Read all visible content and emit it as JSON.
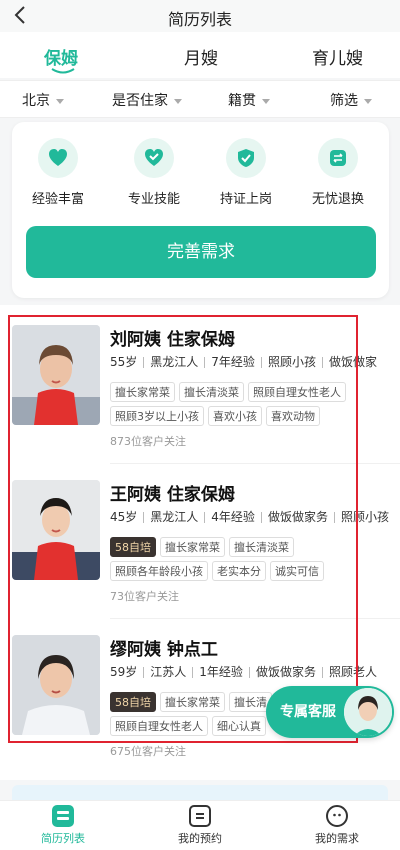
{
  "page": {
    "title": "简历列表"
  },
  "tabs": [
    {
      "label": "保姆",
      "active": true
    },
    {
      "label": "月嫂",
      "active": false
    },
    {
      "label": "育儿嫂",
      "active": false
    }
  ],
  "filters": [
    "北京",
    "是否住家",
    "籍贯",
    "筛选"
  ],
  "features": [
    {
      "label": "经验丰富",
      "icon": "heart-shield-icon"
    },
    {
      "label": "专业技能",
      "icon": "check-heart-icon"
    },
    {
      "label": "持证上岗",
      "icon": "badge-check-icon"
    },
    {
      "label": "无忧退换",
      "icon": "swap-icon"
    }
  ],
  "cta": {
    "label": "完善需求"
  },
  "caregivers": [
    {
      "name": "刘阿姨 住家保姆",
      "meta": [
        "55岁",
        "黑龙江人",
        "7年经验",
        "照顾小孩",
        "做饭做家"
      ],
      "tags_row1": [
        "擅长家常菜",
        "擅长清淡菜",
        "照顾自理女性老人"
      ],
      "tags_row2": [
        "照顾3岁以上小孩",
        "喜欢小孩",
        "喜欢动物"
      ],
      "followers": "873位客户关注"
    },
    {
      "name": "王阿姨 住家保姆",
      "meta": [
        "45岁",
        "黑龙江人",
        "4年经验",
        "做饭做家务",
        "照顾小孩"
      ],
      "badge": "58自培",
      "tags_row1": [
        "擅长家常菜",
        "擅长清淡菜"
      ],
      "tags_row2": [
        "照顾各年龄段小孩",
        "老实本分",
        "诚实可信"
      ],
      "followers": "73位客户关注"
    },
    {
      "name": "缪阿姨 钟点工",
      "meta": [
        "59岁",
        "江苏人",
        "1年经验",
        "做饭做家务",
        "照顾老人"
      ],
      "badge": "58自培",
      "tags_row1": [
        "擅长家常菜",
        "擅长清"
      ],
      "tags_row2": [
        "照顾自理女性老人",
        "细心认真"
      ],
      "followers": "675位客户关注"
    }
  ],
  "fab": {
    "label": "专属客服"
  },
  "nav": [
    {
      "label": "简历列表",
      "active": true
    },
    {
      "label": "我的预约",
      "active": false
    },
    {
      "label": "我的需求",
      "active": false
    }
  ],
  "colors": {
    "accent": "#21b99a",
    "highlight": "#e02330"
  }
}
